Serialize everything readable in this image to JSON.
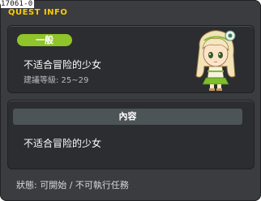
{
  "corner_id": "17061-0",
  "window": {
    "title": "QUEST INFO"
  },
  "quest": {
    "category": "一般",
    "name": "不适合冒险的少女",
    "recommended_level": "建議等級: 25~29"
  },
  "content": {
    "header": "內容",
    "text": "不适合冒险的少女"
  },
  "status": "狀態: 可開始 / 不可執行任務",
  "colors": {
    "title": "#ffcc00",
    "badge": "#8fc42a",
    "panel": "#2b2d30",
    "window": "#3a3c3f"
  },
  "icons": {
    "portrait": "girl-npc-portrait"
  }
}
